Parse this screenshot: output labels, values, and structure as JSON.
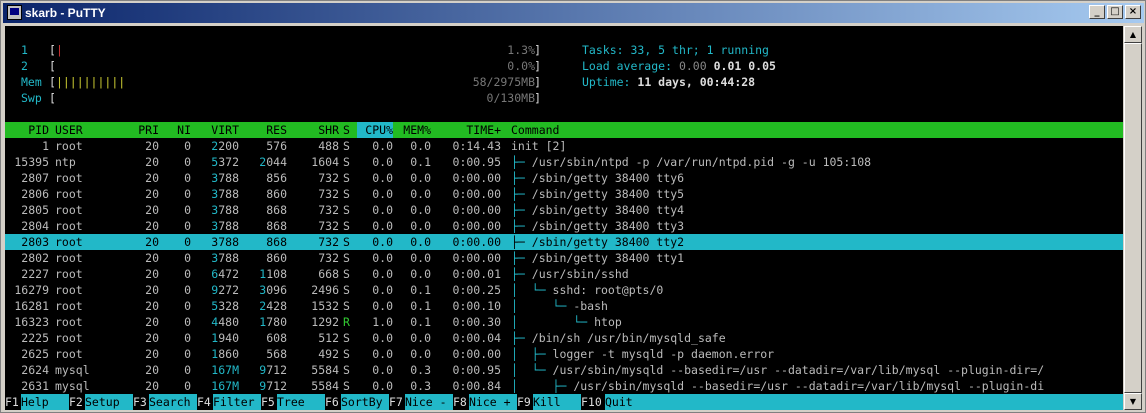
{
  "window": {
    "title": "skarb - PuTTY",
    "buttons": {
      "minimize": "_",
      "maximize": "□",
      "close": "×"
    }
  },
  "meters": [
    {
      "label": "1",
      "bar": "|",
      "bar_color": "#cc3333",
      "value": "1.3%"
    },
    {
      "label": "2",
      "bar": "",
      "bar_color": "#33cc33",
      "value": "0.0%"
    },
    {
      "label": "Mem",
      "bar": "||||||||||",
      "bar_color": "#cccc33",
      "value": "58/2975MB"
    },
    {
      "label": "Swp",
      "bar": "",
      "bar_color": "#cc3333",
      "value": "0/130MB"
    }
  ],
  "info": {
    "tasks_label": "Tasks:",
    "tasks_value": "33, 5 thr; 1 running",
    "load_label": "Load average:",
    "load_1": "0.00",
    "load_5": "0.01",
    "load_15": "0.05",
    "uptime_label": "Uptime:",
    "uptime_value": "11 days, 00:44:28"
  },
  "columns": [
    "PID",
    "USER",
    "PRI",
    "NI",
    "VIRT",
    "RES",
    "SHR",
    "S",
    "CPU%",
    "MEM%",
    "TIME+",
    "Command"
  ],
  "sorted_column": "CPU%",
  "processes": [
    {
      "pid": "1",
      "user": "root",
      "pri": "20",
      "ni": "0",
      "virt": "2200",
      "res": "576",
      "shr": "488",
      "s": "S",
      "cpu": "0.0",
      "mem": "0.0",
      "time": "0:14.43",
      "tree": "",
      "cmd": "init [2]"
    },
    {
      "pid": "15395",
      "user": "ntp",
      "pri": "20",
      "ni": "0",
      "virt": "5372",
      "res": "2044",
      "shr": "1604",
      "s": "S",
      "cpu": "0.0",
      "mem": "0.1",
      "time": "0:00.95",
      "tree": "├─ ",
      "cmd": "/usr/sbin/ntpd -p /var/run/ntpd.pid -g -u 105:108"
    },
    {
      "pid": "2807",
      "user": "root",
      "pri": "20",
      "ni": "0",
      "virt": "3788",
      "res": "856",
      "shr": "732",
      "s": "S",
      "cpu": "0.0",
      "mem": "0.0",
      "time": "0:00.00",
      "tree": "├─ ",
      "cmd": "/sbin/getty 38400 tty6"
    },
    {
      "pid": "2806",
      "user": "root",
      "pri": "20",
      "ni": "0",
      "virt": "3788",
      "res": "860",
      "shr": "732",
      "s": "S",
      "cpu": "0.0",
      "mem": "0.0",
      "time": "0:00.00",
      "tree": "├─ ",
      "cmd": "/sbin/getty 38400 tty5"
    },
    {
      "pid": "2805",
      "user": "root",
      "pri": "20",
      "ni": "0",
      "virt": "3788",
      "res": "868",
      "shr": "732",
      "s": "S",
      "cpu": "0.0",
      "mem": "0.0",
      "time": "0:00.00",
      "tree": "├─ ",
      "cmd": "/sbin/getty 38400 tty4"
    },
    {
      "pid": "2804",
      "user": "root",
      "pri": "20",
      "ni": "0",
      "virt": "3788",
      "res": "868",
      "shr": "732",
      "s": "S",
      "cpu": "0.0",
      "mem": "0.0",
      "time": "0:00.00",
      "tree": "├─ ",
      "cmd": "/sbin/getty 38400 tty3"
    },
    {
      "pid": "2803",
      "user": "root",
      "pri": "20",
      "ni": "0",
      "virt": "3788",
      "res": "868",
      "shr": "732",
      "s": "S",
      "cpu": "0.0",
      "mem": "0.0",
      "time": "0:00.00",
      "tree": "├─ ",
      "cmd": "/sbin/getty 38400 tty2",
      "selected": true
    },
    {
      "pid": "2802",
      "user": "root",
      "pri": "20",
      "ni": "0",
      "virt": "3788",
      "res": "860",
      "shr": "732",
      "s": "S",
      "cpu": "0.0",
      "mem": "0.0",
      "time": "0:00.00",
      "tree": "├─ ",
      "cmd": "/sbin/getty 38400 tty1"
    },
    {
      "pid": "2227",
      "user": "root",
      "pri": "20",
      "ni": "0",
      "virt": "6472",
      "res": "1108",
      "shr": "668",
      "s": "S",
      "cpu": "0.0",
      "mem": "0.0",
      "time": "0:00.01",
      "tree": "├─ ",
      "cmd": "/usr/sbin/sshd"
    },
    {
      "pid": "16279",
      "user": "root",
      "pri": "20",
      "ni": "0",
      "virt": "9272",
      "res": "3096",
      "shr": "2496",
      "s": "S",
      "cpu": "0.0",
      "mem": "0.1",
      "time": "0:00.25",
      "tree": "│  └─ ",
      "cmd": "sshd: root@pts/0"
    },
    {
      "pid": "16281",
      "user": "root",
      "pri": "20",
      "ni": "0",
      "virt": "5328",
      "res": "2428",
      "shr": "1532",
      "s": "S",
      "cpu": "0.0",
      "mem": "0.1",
      "time": "0:00.10",
      "tree": "│     └─ ",
      "cmd": "-bash"
    },
    {
      "pid": "16323",
      "user": "root",
      "pri": "20",
      "ni": "0",
      "virt": "4480",
      "res": "1780",
      "shr": "1292",
      "s": "R",
      "cpu": "1.0",
      "mem": "0.1",
      "time": "0:00.30",
      "tree": "│        └─ ",
      "cmd": "htop"
    },
    {
      "pid": "2225",
      "user": "root",
      "pri": "20",
      "ni": "0",
      "virt": "1940",
      "res": "608",
      "shr": "512",
      "s": "S",
      "cpu": "0.0",
      "mem": "0.0",
      "time": "0:00.04",
      "tree": "├─ ",
      "cmd": "/bin/sh /usr/bin/mysqld_safe"
    },
    {
      "pid": "2625",
      "user": "root",
      "pri": "20",
      "ni": "0",
      "virt": "1860",
      "res": "568",
      "shr": "492",
      "s": "S",
      "cpu": "0.0",
      "mem": "0.0",
      "time": "0:00.00",
      "tree": "│  ├─ ",
      "cmd": "logger -t mysqld -p daemon.error"
    },
    {
      "pid": "2624",
      "user": "mysql",
      "pri": "20",
      "ni": "0",
      "virt": "167M",
      "res": "9712",
      "shr": "5584",
      "s": "S",
      "cpu": "0.0",
      "mem": "0.3",
      "time": "0:00.95",
      "tree": "│  └─ ",
      "cmd": "/usr/sbin/mysqld --basedir=/usr --datadir=/var/lib/mysql --plugin-dir=/"
    },
    {
      "pid": "2631",
      "user": "mysql",
      "pri": "20",
      "ni": "0",
      "virt": "167M",
      "res": "9712",
      "shr": "5584",
      "s": "S",
      "cpu": "0.0",
      "mem": "0.3",
      "time": "0:00.84",
      "tree": "│     ├─ ",
      "cmd": "/usr/sbin/mysqld --basedir=/usr --datadir=/var/lib/mysql --plugin-di"
    }
  ],
  "footer": [
    {
      "key": "F1",
      "label": "Help"
    },
    {
      "key": "F2",
      "label": "Setup"
    },
    {
      "key": "F3",
      "label": "Search"
    },
    {
      "key": "F4",
      "label": "Filter"
    },
    {
      "key": "F5",
      "label": "Tree"
    },
    {
      "key": "F6",
      "label": "SortBy"
    },
    {
      "key": "F7",
      "label": "Nice -"
    },
    {
      "key": "F8",
      "label": "Nice +"
    },
    {
      "key": "F9",
      "label": "Kill"
    },
    {
      "key": "F10",
      "label": "Quit"
    }
  ]
}
